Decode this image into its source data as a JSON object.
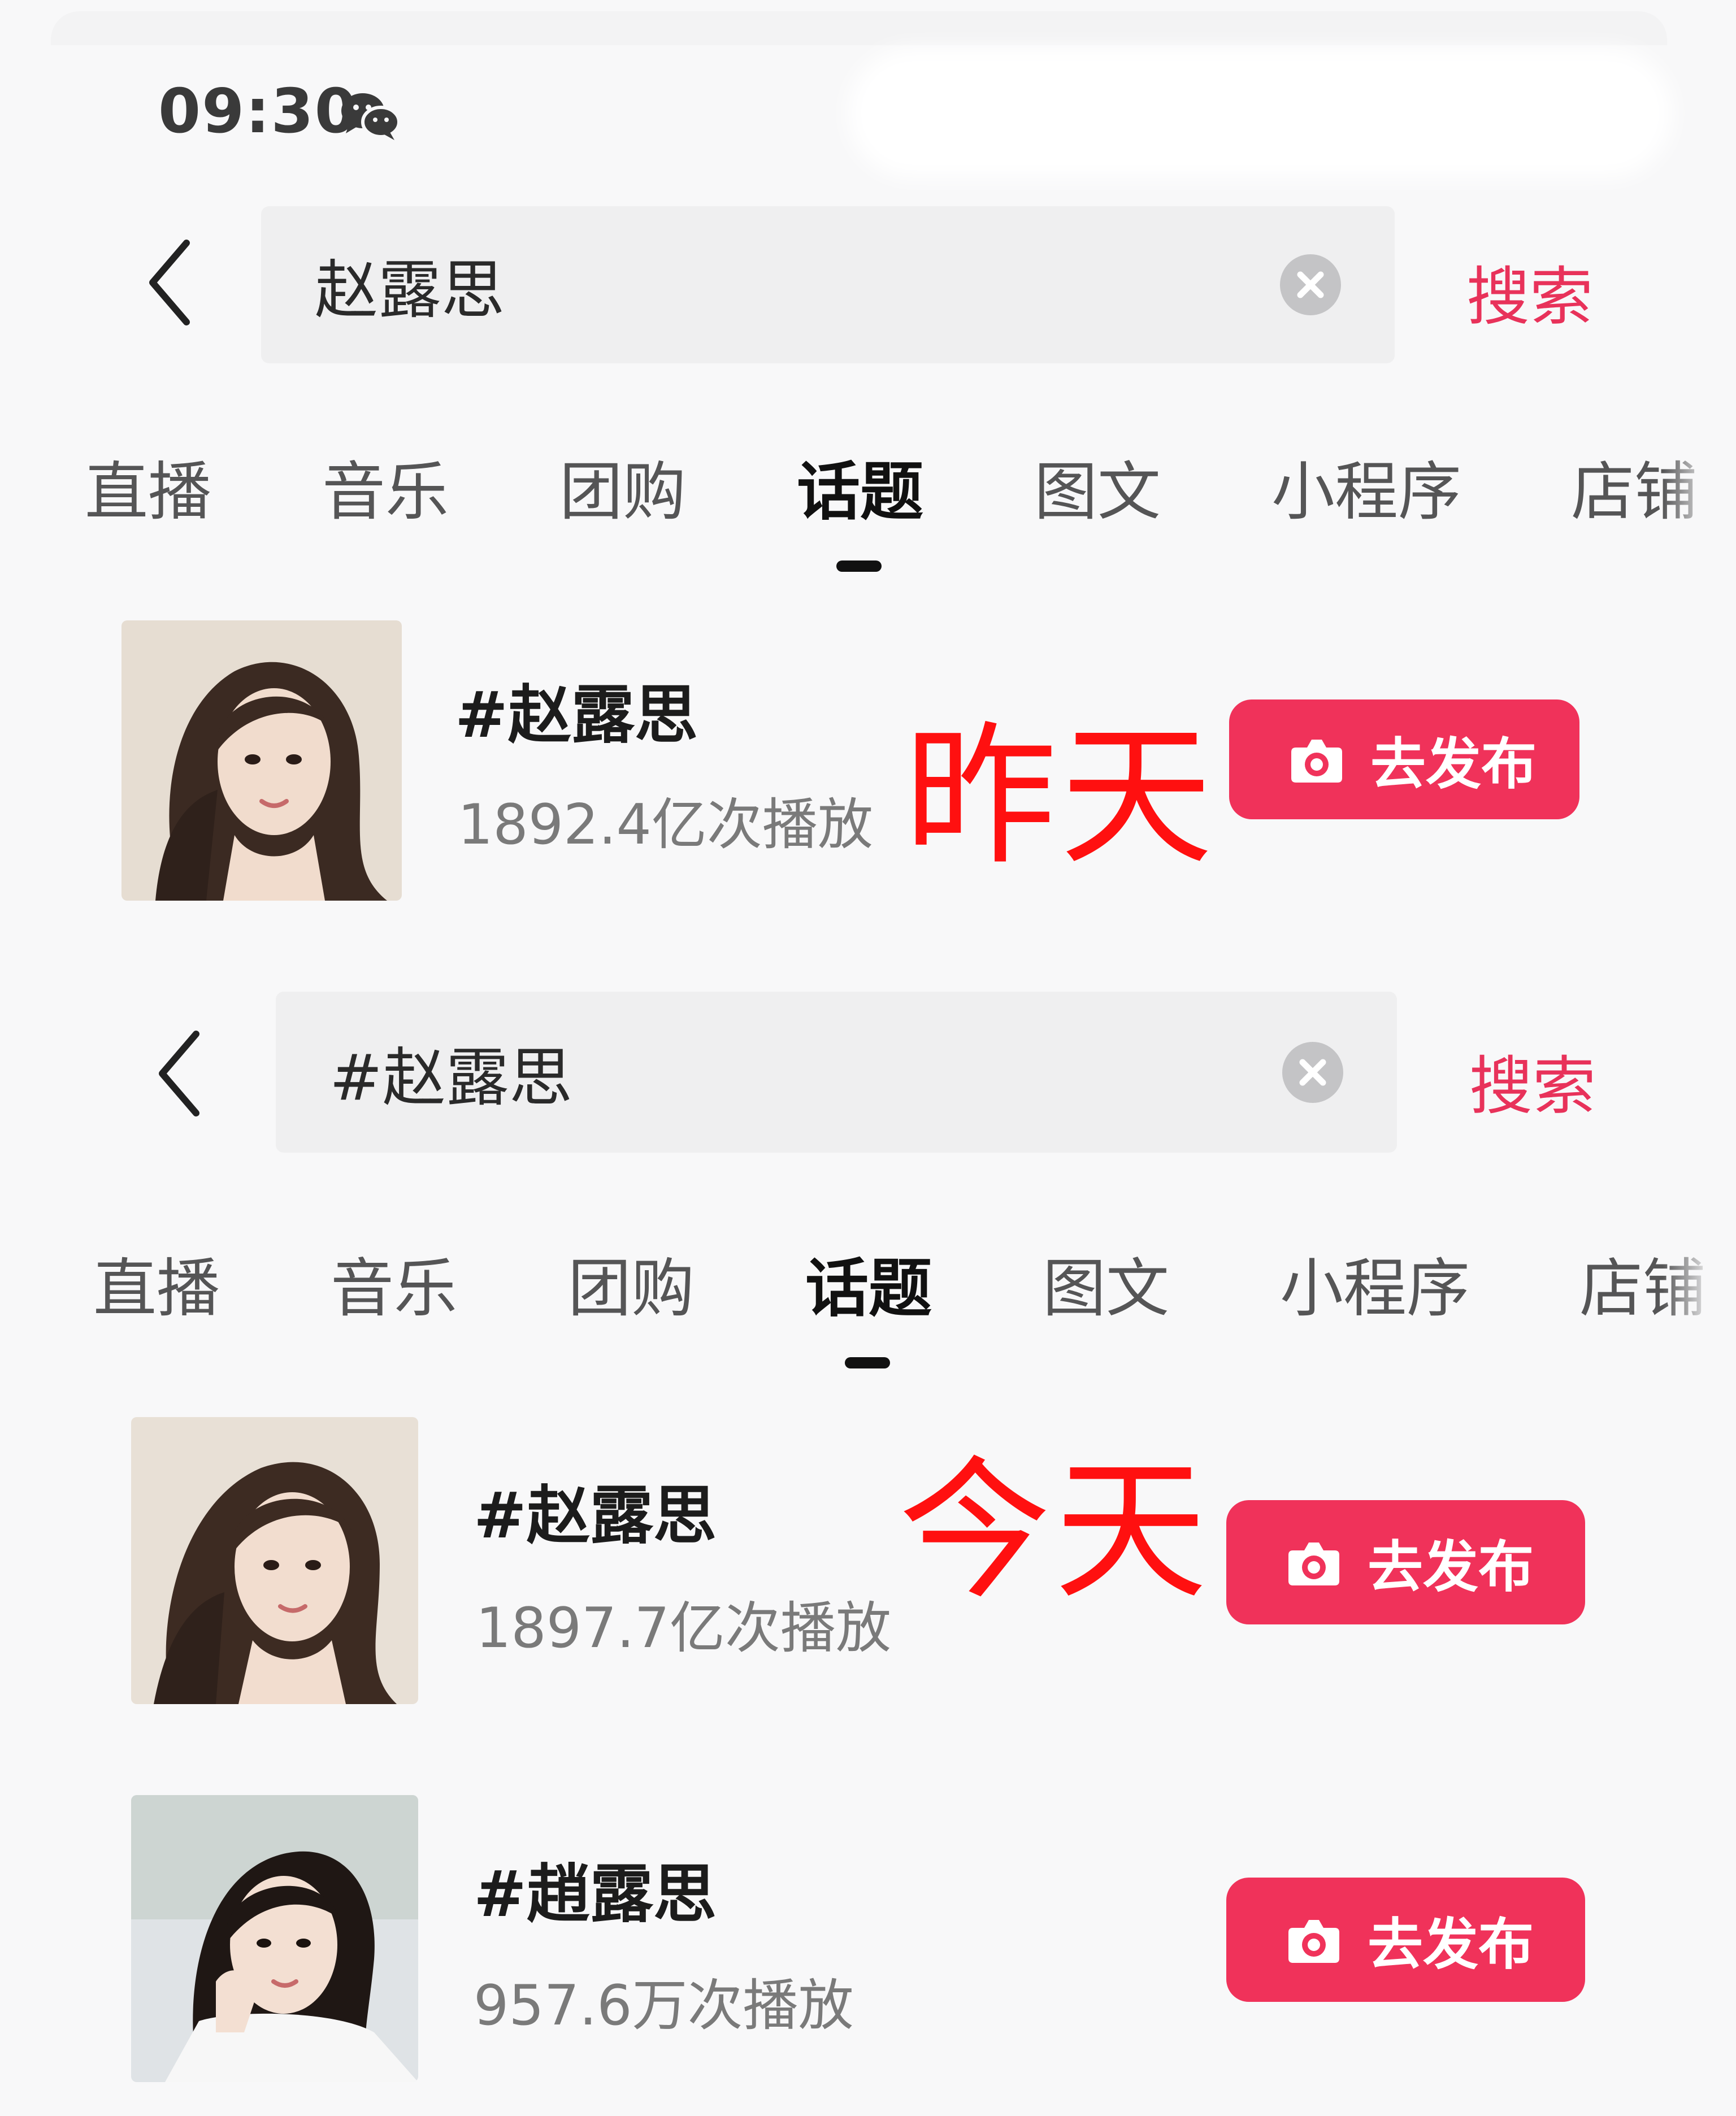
{
  "status_bar": {
    "time": "09:30",
    "app_icon": "wechat-icon"
  },
  "screens": [
    {
      "search": {
        "query": "赵露思",
        "submit_label": "搜索"
      },
      "tabs": [
        "直播",
        "音乐",
        "团购",
        "话题",
        "图文",
        "小程序",
        "店铺"
      ],
      "active_tab": "话题",
      "topics": [
        {
          "title": "#赵露思",
          "plays": "1892.4亿次播放",
          "button": "去发布"
        }
      ],
      "overlay": "昨天"
    },
    {
      "search": {
        "query": "#赵露思",
        "submit_label": "搜索"
      },
      "tabs": [
        "直播",
        "音乐",
        "团购",
        "话题",
        "图文",
        "小程序",
        "店铺"
      ],
      "active_tab": "话题",
      "topics": [
        {
          "title": "#赵露思",
          "plays": "1897.7亿次播放",
          "button": "去发布"
        },
        {
          "title": "#趙露思",
          "plays": "957.6万次播放",
          "button": "去发布"
        }
      ],
      "overlay": "今天"
    }
  ],
  "colors": {
    "accent": "#f0325a",
    "search_link": "#e8325a",
    "overlay": "#ff1010"
  }
}
